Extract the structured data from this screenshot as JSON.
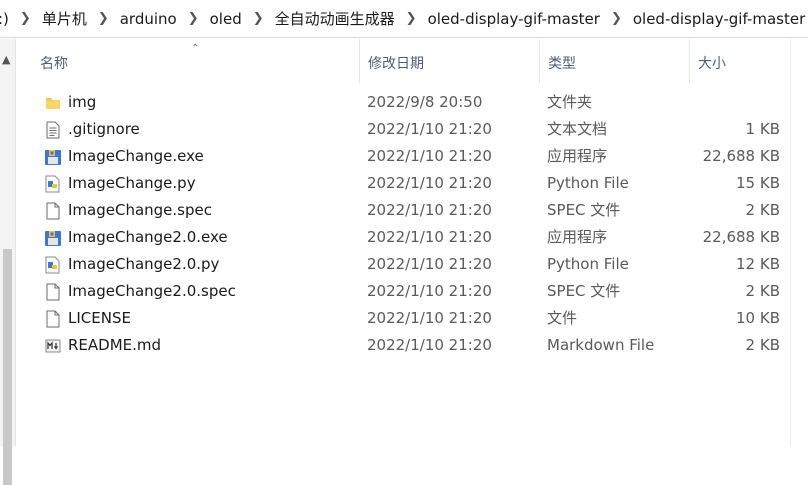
{
  "breadcrumb": [
    {
      "label": ":)"
    },
    {
      "label": "单片机"
    },
    {
      "label": "arduino"
    },
    {
      "label": "oled"
    },
    {
      "label": "全自动动画生成器"
    },
    {
      "label": "oled-display-gif-master"
    },
    {
      "label": "oled-display-gif-master"
    }
  ],
  "columns": {
    "name": "名称",
    "modified": "修改日期",
    "type": "类型",
    "size": "大小"
  },
  "files": [
    {
      "name": "img",
      "modified": "2022/9/8 20:50",
      "type": "文件夹",
      "size": "",
      "icon": "folder-icon"
    },
    {
      "name": ".gitignore",
      "modified": "2022/1/10 21:20",
      "type": "文本文档",
      "size": "1 KB",
      "icon": "text-document-icon"
    },
    {
      "name": "ImageChange.exe",
      "modified": "2022/1/10 21:20",
      "type": "应用程序",
      "size": "22,688 KB",
      "icon": "python-exe-icon"
    },
    {
      "name": "ImageChange.py",
      "modified": "2022/1/10 21:20",
      "type": "Python File",
      "size": "15 KB",
      "icon": "python-file-icon"
    },
    {
      "name": "ImageChange.spec",
      "modified": "2022/1/10 21:20",
      "type": "SPEC 文件",
      "size": "2 KB",
      "icon": "blank-file-icon"
    },
    {
      "name": "ImageChange2.0.exe",
      "modified": "2022/1/10 21:20",
      "type": "应用程序",
      "size": "22,688 KB",
      "icon": "python-exe-icon"
    },
    {
      "name": "ImageChange2.0.py",
      "modified": "2022/1/10 21:20",
      "type": "Python File",
      "size": "12 KB",
      "icon": "python-file-icon"
    },
    {
      "name": "ImageChange2.0.spec",
      "modified": "2022/1/10 21:20",
      "type": "SPEC 文件",
      "size": "2 KB",
      "icon": "blank-file-icon"
    },
    {
      "name": "LICENSE",
      "modified": "2022/1/10 21:20",
      "type": "文件",
      "size": "10 KB",
      "icon": "blank-file-icon"
    },
    {
      "name": "README.md",
      "modified": "2022/1/10 21:20",
      "type": "Markdown File",
      "size": "2 KB",
      "icon": "markdown-file-icon"
    }
  ]
}
